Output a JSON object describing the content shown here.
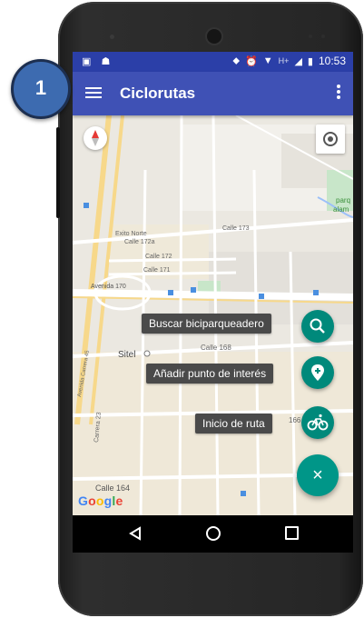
{
  "status_bar": {
    "time": "10:53",
    "network": "H+"
  },
  "app_bar": {
    "title": "Ciclorutas"
  },
  "map_labels": {
    "street_calle_173": "Calle 173",
    "street_calle_172a": "Calle 172a",
    "street_calle_172": "Calle 172",
    "street_calle_171": "Calle 171",
    "street_calle_168": "Calle 168",
    "street_calle_164": "Calle 164",
    "street_calle_166": "166",
    "street_avenida_170": "Avenida 170",
    "street_exito": "Exito Norte",
    "poi_sitel": "Sitel",
    "park_label_1": "parq",
    "park_label_2": "alam",
    "street_carrera_45": "Avenida Carrera 45",
    "street_carrera_23": "Carrera 23",
    "google": "Google"
  },
  "fab_menu": [
    {
      "label": "Buscar biciparqueadero",
      "icon": "search-icon"
    },
    {
      "label": "Añadir punto de interés",
      "icon": "location-pin-icon"
    },
    {
      "label": "Inicio de ruta",
      "icon": "bicycle-icon"
    }
  ],
  "fab_main_symbol": "×",
  "callout_number": "1",
  "colors": {
    "app_bar": "#3f51b5",
    "status_bar": "#2b3fa8",
    "fab": "#00897b",
    "callout": "#3d6bb0"
  }
}
